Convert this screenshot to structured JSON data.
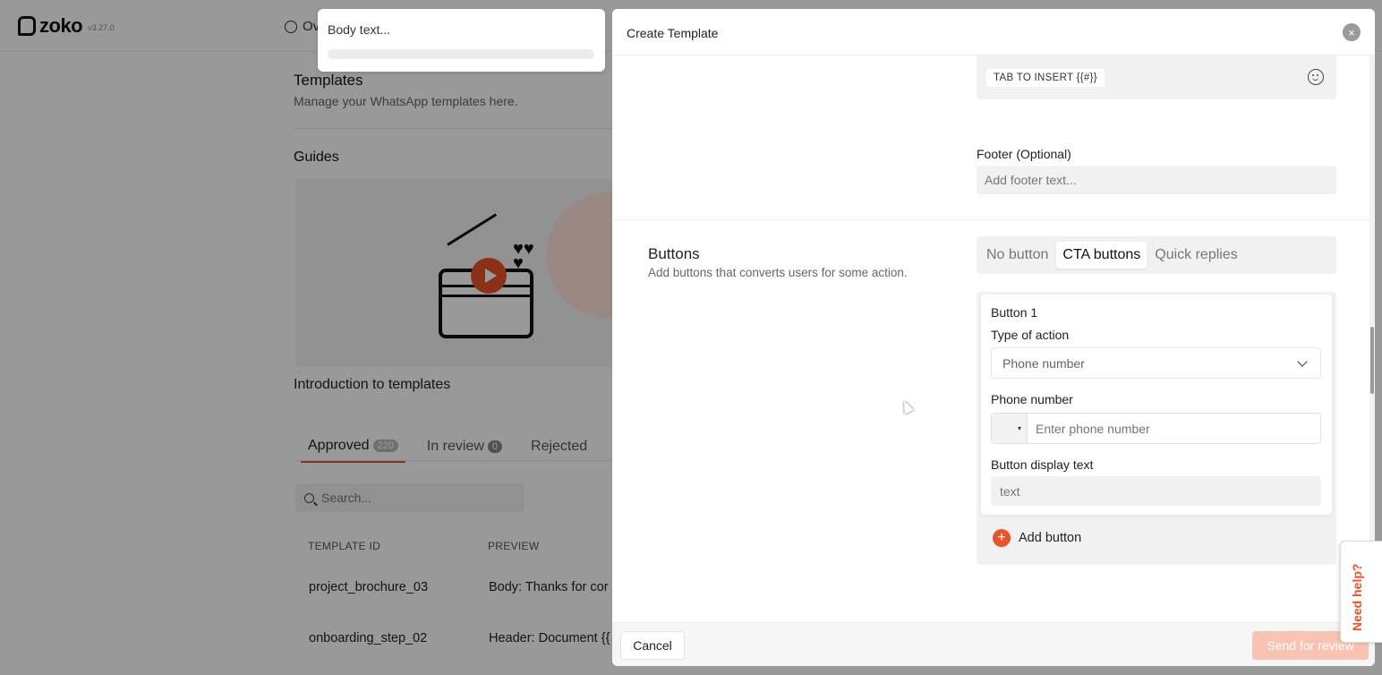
{
  "app": {
    "name": "zoko",
    "version": "v3.27.0",
    "nav_item": "Ov"
  },
  "templates_page": {
    "title": "Templates",
    "subtitle": "Manage your WhatsApp templates here.",
    "guides_title": "Guides",
    "guide_caption": "Introduction to templates",
    "tabs": [
      {
        "label": "Approved",
        "count": "220"
      },
      {
        "label": "In review",
        "count": "0"
      },
      {
        "label": "Rejected",
        "count": ""
      }
    ],
    "search_placeholder": "Search...",
    "columns": [
      "TEMPLATE ID",
      "PREVIEW"
    ],
    "rows": [
      {
        "id": "project_brochure_03",
        "preview": "Body: Thanks for cor"
      },
      {
        "id": "onboarding_step_02",
        "preview": "Header: Document {{"
      }
    ]
  },
  "body_popup": {
    "text": "Body text..."
  },
  "modal": {
    "title": "Create Template",
    "close_icon": "×",
    "insert_chip": "TAB TO INSERT {{#}}",
    "footer_label": "Footer (Optional)",
    "footer_placeholder": "Add footer text...",
    "buttons_section": {
      "title": "Buttons",
      "subtitle": "Add buttons that converts users for some action.",
      "options": [
        "No button",
        "CTA buttons",
        "Quick replies"
      ],
      "selected": "CTA buttons"
    },
    "button_card": {
      "heading": "Button 1",
      "action_label": "Type of action",
      "action_value": "Phone number",
      "phone_label": "Phone number",
      "phone_placeholder": "Enter phone number",
      "country_caret": "▾",
      "display_label": "Button display text",
      "display_placeholder": "text"
    },
    "add_button_label": "Add button",
    "add_icon": "+",
    "cancel_label": "Cancel",
    "send_label": "Send for review"
  },
  "help": {
    "label": "Need help?"
  },
  "colors": {
    "accent": "#e8532c",
    "overlay": "rgba(0,0,0,0.40)"
  }
}
